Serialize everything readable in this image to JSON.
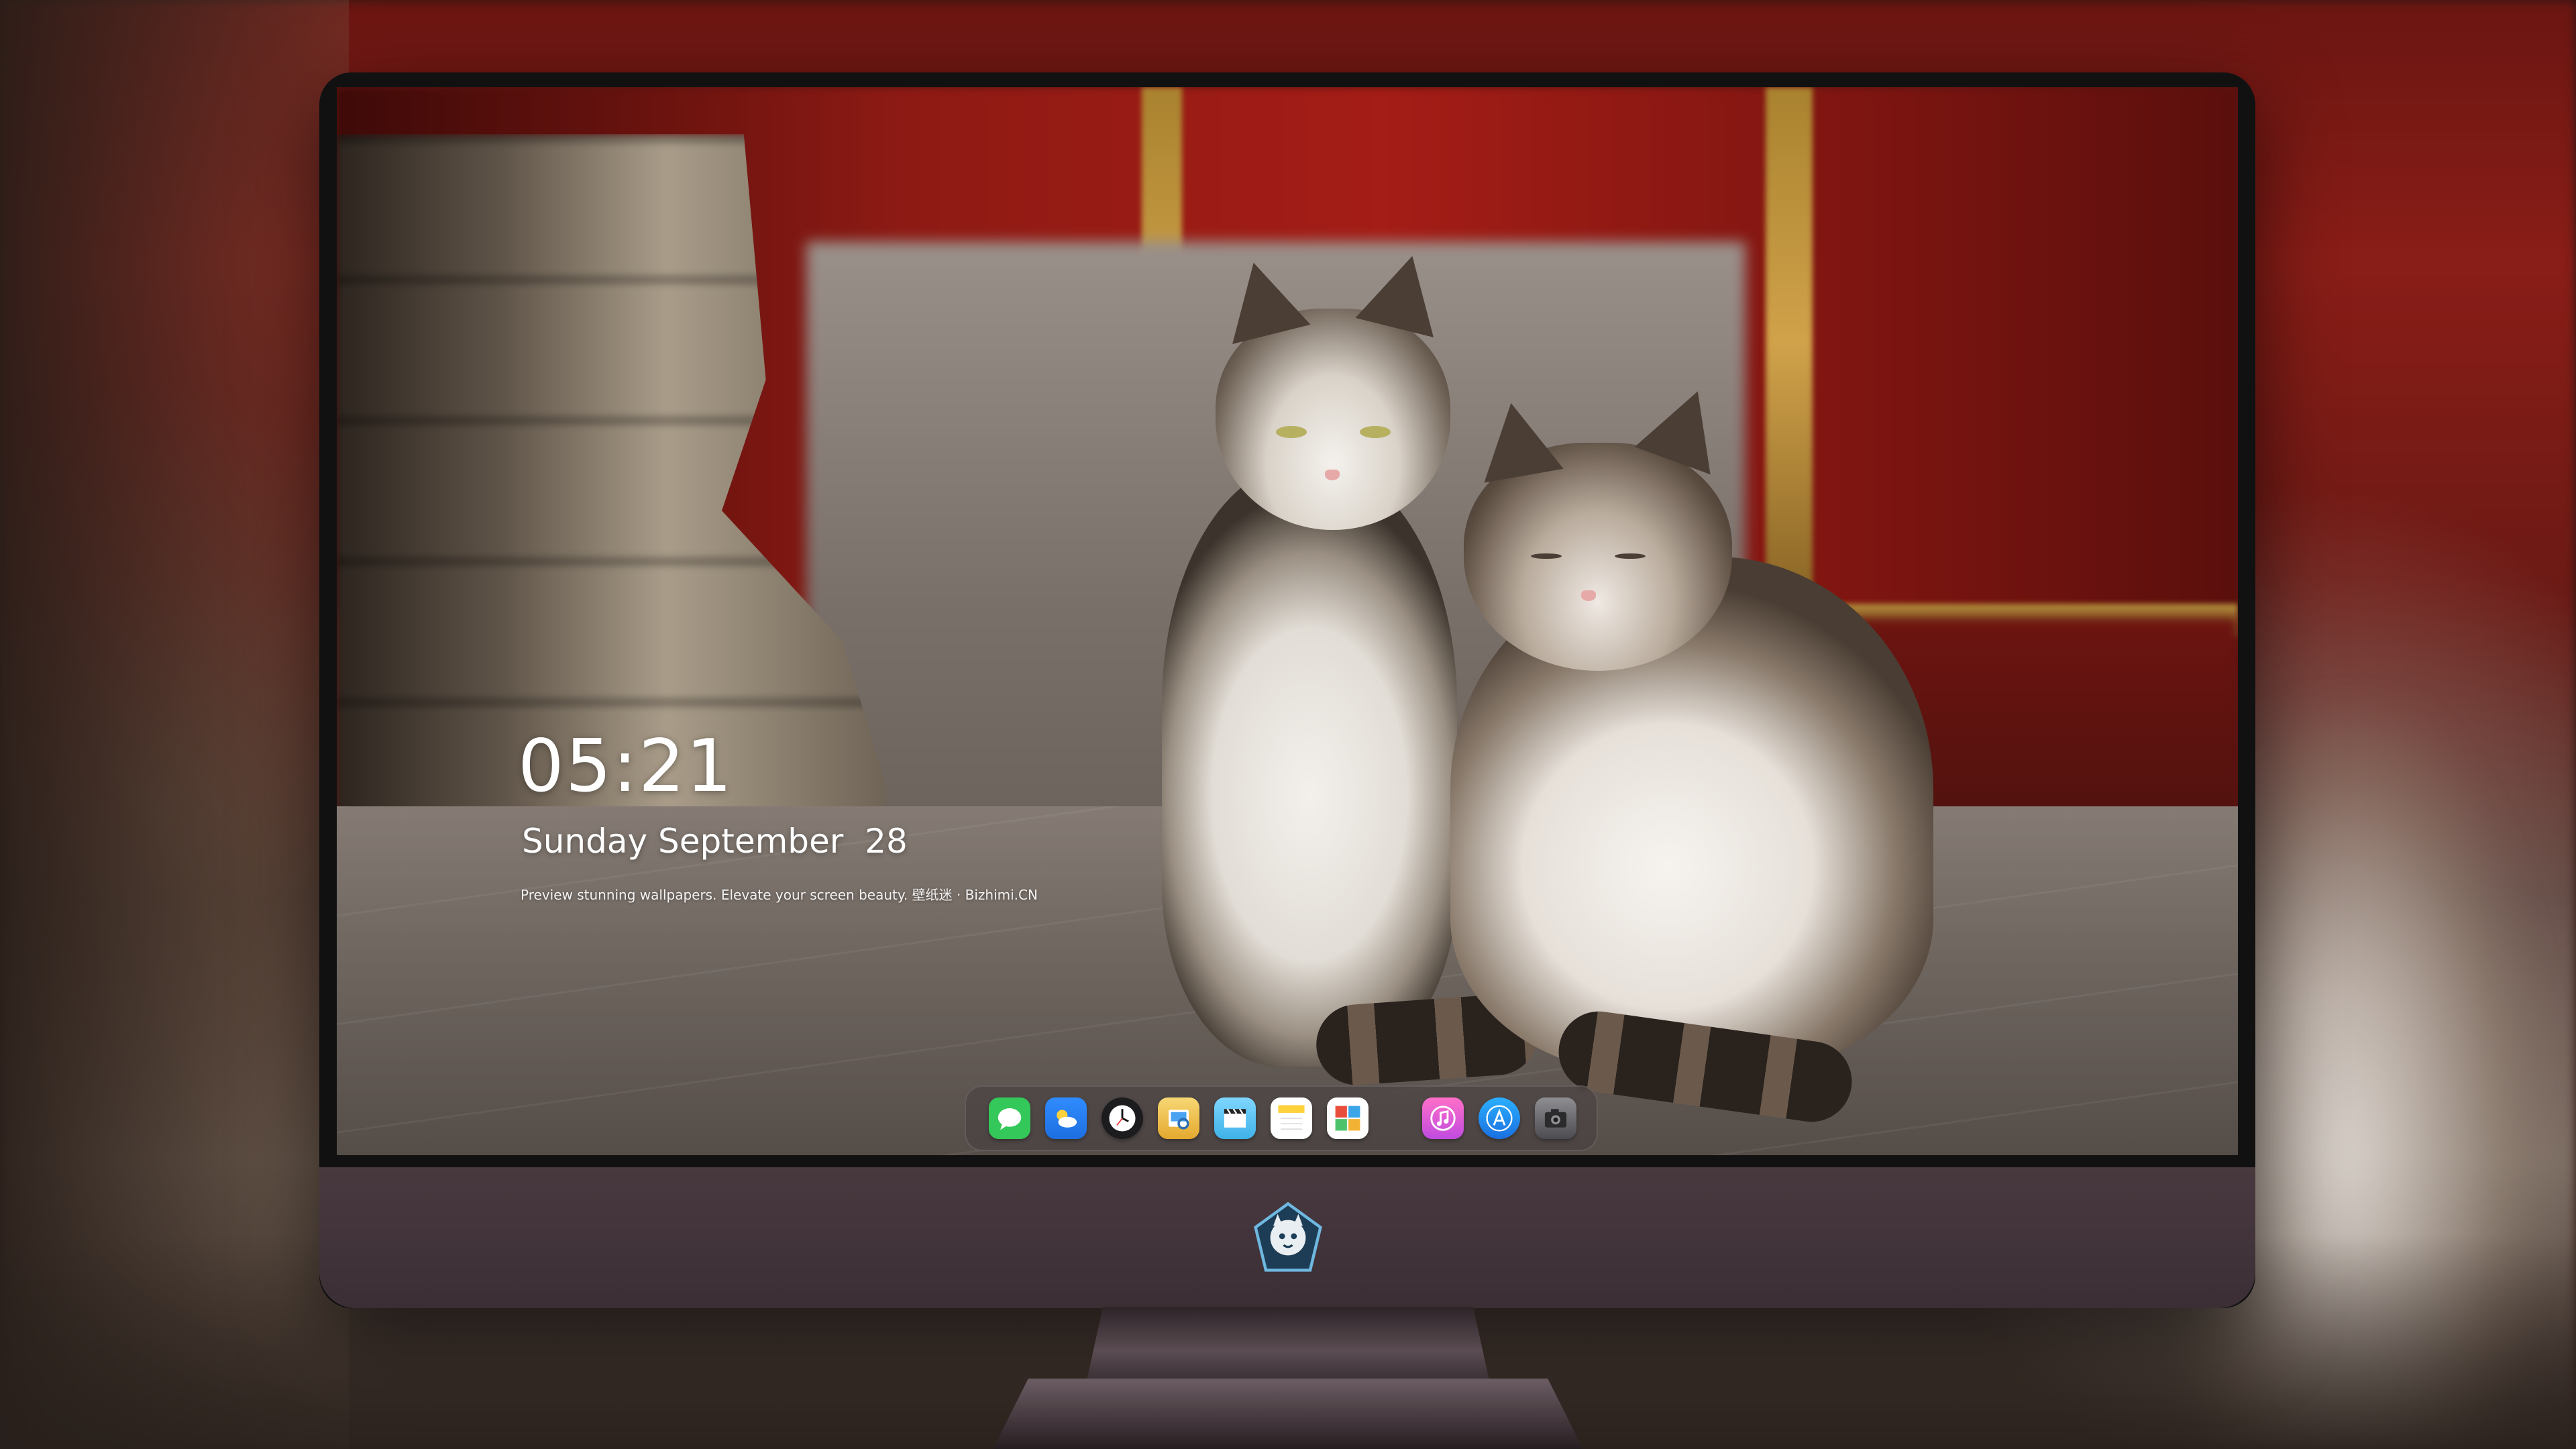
{
  "lockscreen": {
    "time": "05:21",
    "date": "Sunday September  28",
    "tagline": "Preview stunning wallpapers. Elevate your screen beauty. 壁纸迷 · Bizhimi.CN"
  },
  "dock": {
    "apps": [
      {
        "name": "messages-icon",
        "color": "#34c759"
      },
      {
        "name": "weather-icon",
        "color": "#1e8ef0"
      },
      {
        "name": "clock-icon",
        "color": "#1c1c1e"
      },
      {
        "name": "preview-icon",
        "color": "#f2c94c"
      },
      {
        "name": "video-editor-icon",
        "color": "#5ac8fa"
      },
      {
        "name": "notes-icon",
        "color": "#ffd84d"
      },
      {
        "name": "photo-booth-icon",
        "color": "#e94e3c"
      },
      {
        "name": "music-icon",
        "color": "#ff4fa2"
      },
      {
        "name": "app-store-icon",
        "color": "#1a7cf0"
      },
      {
        "name": "camera-icon",
        "color": "#6e6e73"
      }
    ]
  }
}
